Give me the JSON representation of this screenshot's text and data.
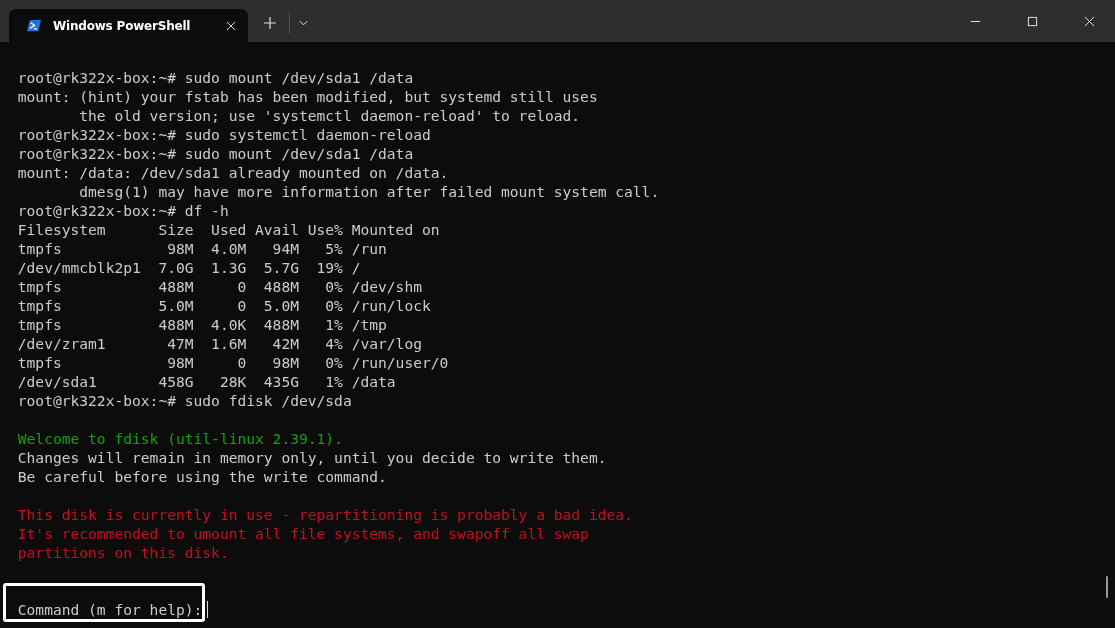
{
  "tabs": [
    {
      "label": "Windows PowerShell",
      "selected": true
    }
  ],
  "terminal": {
    "lines": [
      {
        "kind": "output",
        "text": "root@rk322x-box:~# sudo mount /dev/sda1 /data"
      },
      {
        "kind": "output",
        "text": "mount: (hint) your fstab has been modified, but systemd still uses"
      },
      {
        "kind": "output",
        "text": "       the old version; use 'systemctl daemon-reload' to reload."
      },
      {
        "kind": "output",
        "text": "root@rk322x-box:~# sudo systemctl daemon-reload"
      },
      {
        "kind": "output",
        "text": "root@rk322x-box:~# sudo mount /dev/sda1 /data"
      },
      {
        "kind": "output",
        "text": "mount: /data: /dev/sda1 already mounted on /data."
      },
      {
        "kind": "output",
        "text": "       dmesg(1) may have more information after failed mount system call."
      },
      {
        "kind": "output",
        "text": "root@rk322x-box:~# df -h"
      },
      {
        "kind": "output",
        "text": "Filesystem      Size  Used Avail Use% Mounted on"
      },
      {
        "kind": "output",
        "text": "tmpfs            98M  4.0M   94M   5% /run"
      },
      {
        "kind": "output",
        "text": "/dev/mmcblk2p1  7.0G  1.3G  5.7G  19% /"
      },
      {
        "kind": "output",
        "text": "tmpfs           488M     0  488M   0% /dev/shm"
      },
      {
        "kind": "output",
        "text": "tmpfs           5.0M     0  5.0M   0% /run/lock"
      },
      {
        "kind": "output",
        "text": "tmpfs           488M  4.0K  488M   1% /tmp"
      },
      {
        "kind": "output",
        "text": "/dev/zram1       47M  1.6M   42M   4% /var/log"
      },
      {
        "kind": "output",
        "text": "tmpfs            98M     0   98M   0% /run/user/0"
      },
      {
        "kind": "output",
        "text": "/dev/sda1       458G   28K  435G   1% /data"
      },
      {
        "kind": "output",
        "text": "root@rk322x-box:~# sudo fdisk /dev/sda"
      },
      {
        "kind": "blank"
      },
      {
        "kind": "success",
        "text": "Welcome to fdisk (util-linux 2.39.1)."
      },
      {
        "kind": "output",
        "text": "Changes will remain in memory only, until you decide to write them."
      },
      {
        "kind": "output",
        "text": "Be careful before using the write command."
      },
      {
        "kind": "blank"
      },
      {
        "kind": "error",
        "text": "This disk is currently in use - repartitioning is probably a bad idea."
      },
      {
        "kind": "error",
        "text": "It's recommended to umount all file systems, and swapoff all swap"
      },
      {
        "kind": "error",
        "text": "partitions on this disk."
      },
      {
        "kind": "blank"
      },
      {
        "kind": "blank"
      },
      {
        "kind": "prompt",
        "text": "Command (m for help):",
        "highlighted": true
      }
    ]
  }
}
